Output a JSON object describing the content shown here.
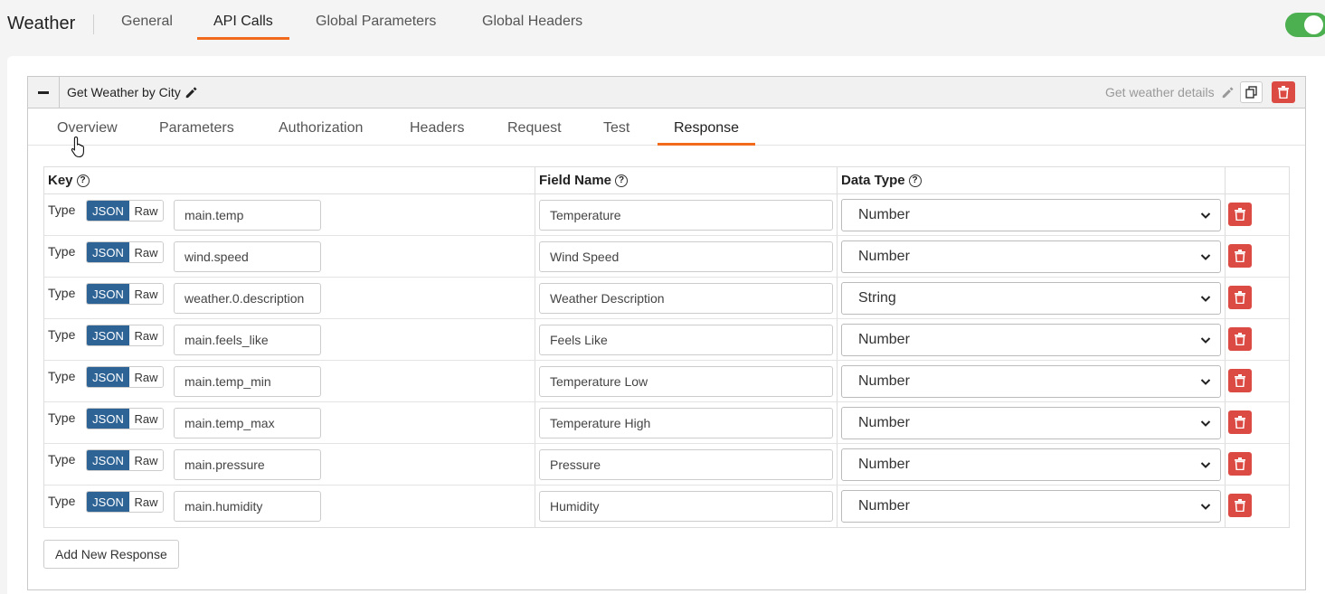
{
  "header": {
    "app_title": "Weather",
    "tabs": [
      {
        "label": "General"
      },
      {
        "label": "API Calls"
      },
      {
        "label": "Global Parameters"
      },
      {
        "label": "Global Headers"
      }
    ],
    "active_tab": "API Calls",
    "toggle_on": true
  },
  "api_call": {
    "name": "Get Weather by City",
    "description": "Get weather details",
    "subtabs": [
      {
        "label": "Overview"
      },
      {
        "label": "Parameters"
      },
      {
        "label": "Authorization"
      },
      {
        "label": "Headers"
      },
      {
        "label": "Request"
      },
      {
        "label": "Test"
      },
      {
        "label": "Response"
      }
    ],
    "active_subtab": "Response"
  },
  "table": {
    "headers": {
      "key": "Key",
      "field_name": "Field Name",
      "data_type": "Data Type"
    },
    "type_label": "Type",
    "json_label": "JSON",
    "raw_label": "Raw",
    "rows": [
      {
        "key": "main.temp",
        "field": "Temperature",
        "data_type": "Number"
      },
      {
        "key": "wind.speed",
        "field": "Wind Speed",
        "data_type": "Number"
      },
      {
        "key": "weather.0.description",
        "field": "Weather Description",
        "data_type": "String"
      },
      {
        "key": "main.feels_like",
        "field": "Feels Like",
        "data_type": "Number"
      },
      {
        "key": "main.temp_min",
        "field": "Temperature Low",
        "data_type": "Number"
      },
      {
        "key": "main.temp_max",
        "field": "Temperature High",
        "data_type": "Number"
      },
      {
        "key": "main.pressure",
        "field": "Pressure",
        "data_type": "Number"
      },
      {
        "key": "main.humidity",
        "field": "Humidity",
        "data_type": "Number"
      }
    ]
  },
  "add_button_label": "Add New Response",
  "colors": {
    "accent": "#f26b1d",
    "json_active": "#2e6395",
    "danger": "#dc4a44",
    "toggle": "#4caf50"
  }
}
